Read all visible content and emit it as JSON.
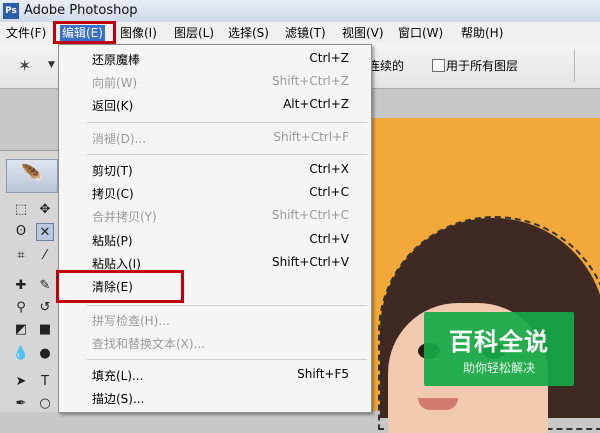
{
  "window": {
    "title": "Adobe Photoshop",
    "app_icon": "Ps"
  },
  "menubar": [
    {
      "label": "文件(F)"
    },
    {
      "label": "编辑(E)",
      "active": true
    },
    {
      "label": "图像(I)"
    },
    {
      "label": "图层(L)"
    },
    {
      "label": "选择(S)"
    },
    {
      "label": "滤镜(T)"
    },
    {
      "label": "视图(V)"
    },
    {
      "label": "窗口(W)"
    },
    {
      "label": "帮助(H)"
    }
  ],
  "options_bar": {
    "tool_icon": "magic-wand-icon",
    "contiguous_label": "连续的",
    "all_layers_label": "用于所有图层",
    "all_layers_checked": false
  },
  "edit_menu": {
    "items": [
      {
        "label": "还原魔棒",
        "shortcut": "Ctrl+Z",
        "enabled": true
      },
      {
        "label": "向前(W)",
        "shortcut": "Shift+Ctrl+Z",
        "enabled": false
      },
      {
        "label": "返回(K)",
        "shortcut": "Alt+Ctrl+Z",
        "enabled": true
      },
      {
        "label": "消褪(D)...",
        "shortcut": "Shift+Ctrl+F",
        "enabled": false
      },
      {
        "label": "剪切(T)",
        "shortcut": "Ctrl+X",
        "enabled": true
      },
      {
        "label": "拷贝(C)",
        "shortcut": "Ctrl+C",
        "enabled": true
      },
      {
        "label": "合并拷贝(Y)",
        "shortcut": "Shift+Ctrl+C",
        "enabled": false
      },
      {
        "label": "粘贴(P)",
        "shortcut": "Ctrl+V",
        "enabled": true
      },
      {
        "label": "粘贴入(I)",
        "shortcut": "Shift+Ctrl+V",
        "enabled": true
      },
      {
        "label": "清除(E)",
        "shortcut": "",
        "enabled": true,
        "highlighted": true
      },
      {
        "label": "拼写检查(H)...",
        "shortcut": "",
        "enabled": false
      },
      {
        "label": "查找和替换文本(X)...",
        "shortcut": "",
        "enabled": false
      },
      {
        "label": "填充(L)...",
        "shortcut": "Shift+F5",
        "enabled": true
      },
      {
        "label": "描边(S)...",
        "shortcut": "",
        "enabled": true
      }
    ]
  },
  "watermark": {
    "title": "百科全说",
    "subtitle": "助你轻松解决"
  },
  "colors": {
    "highlight_red": "#c00010",
    "canvas_bg": "#f3a93a",
    "watermark_green": "#14aa46"
  }
}
